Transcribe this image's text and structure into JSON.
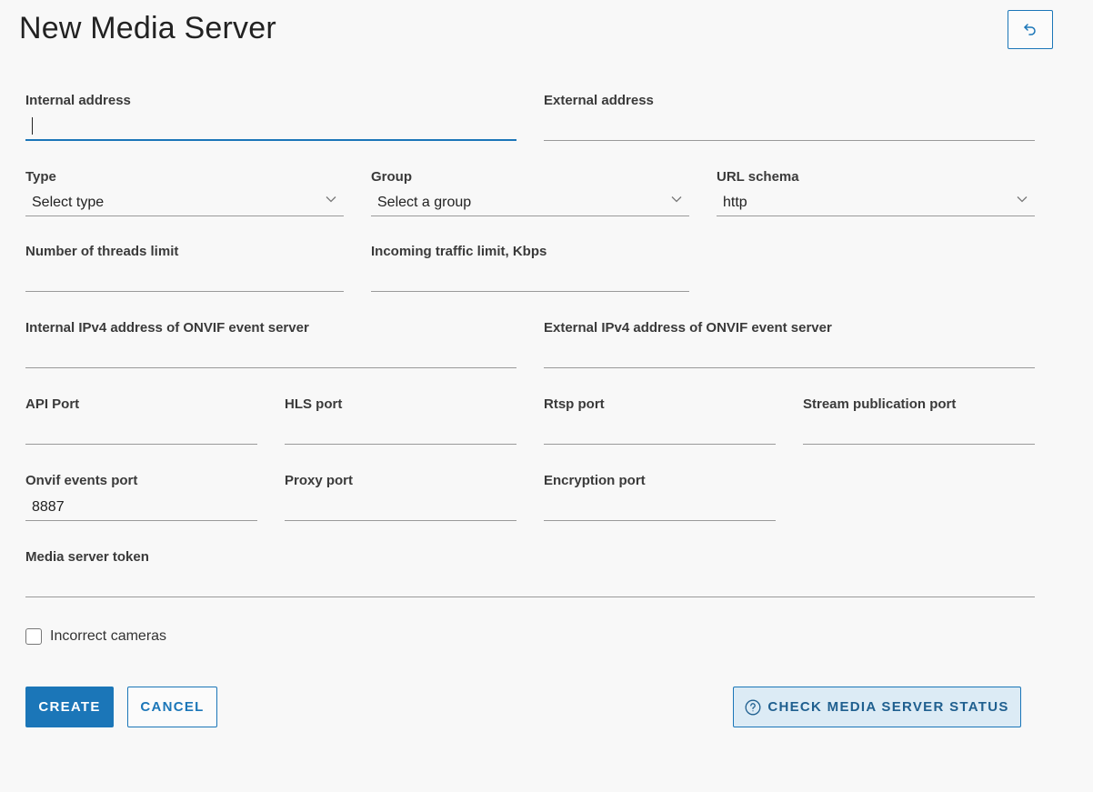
{
  "page": {
    "title": "New Media Server"
  },
  "fields": {
    "internal_address": {
      "label": "Internal address",
      "value": ""
    },
    "external_address": {
      "label": "External address",
      "value": ""
    },
    "type": {
      "label": "Type",
      "value": "Select type"
    },
    "group": {
      "label": "Group",
      "value": "Select a group"
    },
    "url_schema": {
      "label": "URL schema",
      "value": "http"
    },
    "threads_limit": {
      "label": "Number of threads limit",
      "value": ""
    },
    "incoming_traffic": {
      "label": "Incoming traffic limit, Kbps",
      "value": ""
    },
    "internal_onvif": {
      "label": "Internal IPv4 address of ONVIF event server",
      "value": ""
    },
    "external_onvif": {
      "label": "External IPv4 address of ONVIF event server",
      "value": ""
    },
    "api_port": {
      "label": "API Port",
      "value": ""
    },
    "hls_port": {
      "label": "HLS port",
      "value": ""
    },
    "rtsp_port": {
      "label": "Rtsp port",
      "value": ""
    },
    "stream_port": {
      "label": "Stream publication port",
      "value": ""
    },
    "onvif_events_port": {
      "label": "Onvif events port",
      "value": "8887"
    },
    "proxy_port": {
      "label": "Proxy port",
      "value": ""
    },
    "encryption_port": {
      "label": "Encryption port",
      "value": ""
    },
    "media_token": {
      "label": "Media server token",
      "value": ""
    }
  },
  "checkbox": {
    "label": "Incorrect cameras",
    "checked": false
  },
  "buttons": {
    "create": "CREATE",
    "cancel": "CANCEL",
    "check_status": "CHECK MEDIA SERVER STATUS"
  },
  "icons": {
    "back": "undo-arrow-icon",
    "select": "chevron-down-icon",
    "help": "question-circle-icon"
  },
  "colors": {
    "accent": "#1b76b8",
    "background": "#f8f8f8",
    "status_button_bg": "#dcebf5"
  }
}
